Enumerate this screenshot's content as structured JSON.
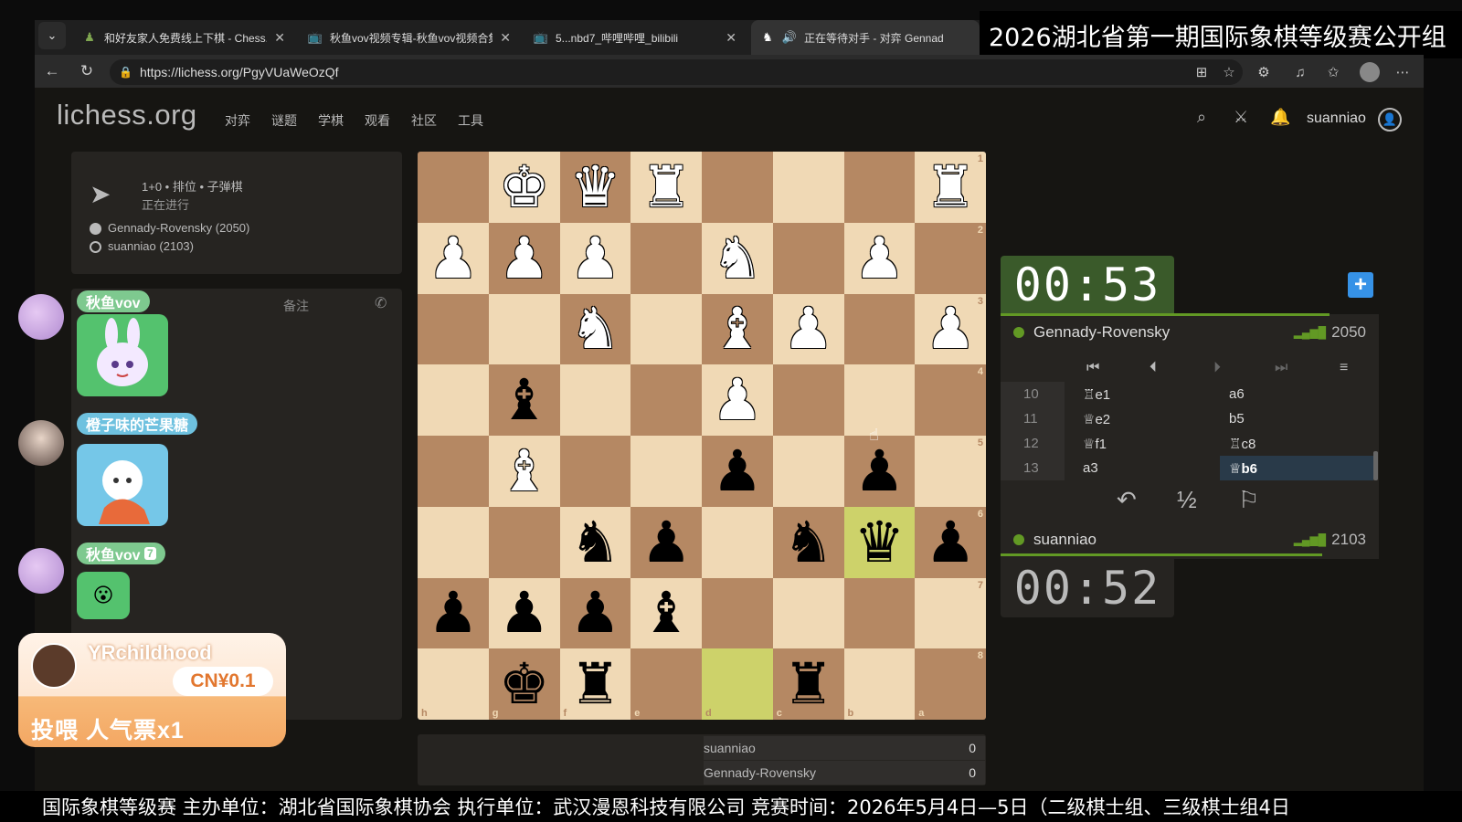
{
  "browser": {
    "tabs": [
      {
        "title": "和好友家人免费线上下棋 - Chess.c",
        "icon": "pawn-icon"
      },
      {
        "title": "秋鱼vov视频专辑-秋鱼vov视频合集",
        "icon": "bilibili-icon"
      },
      {
        "title": "5...nbd7_哔哩哔哩_bilibili",
        "icon": "bilibili-icon"
      },
      {
        "title": "正在等待对手 - 对弈 Gennad",
        "icon": "lichess-icon"
      }
    ],
    "url": "https://lichess.org/PgyVUaWeOzQf"
  },
  "stream_title": "2026湖北省第一期国际象棋等级赛公开组",
  "ticker": "国际象棋等级赛 主办单位：湖北省国际象棋协会 执行单位：武汉漫恩科技有限公司 竞赛时间：2026年5月4日—5日（二级棋士组、三级棋士组4日",
  "site": {
    "logo": "lichess.org",
    "nav": [
      "对弈",
      "谜题",
      "学棋",
      "观看",
      "社区",
      "工具"
    ],
    "username": "suanniao"
  },
  "game_info": {
    "mode": "1+0 • 排位 • 子弹棋",
    "status": "正在进行",
    "white_player": "Gennady-Rovensky (2050)",
    "black_player": "suanniao (2103)"
  },
  "chat": {
    "notes_tab": "备注",
    "messages": [
      {
        "user": "秋鱼vov",
        "badge": "7"
      },
      {
        "user": "橙子味的芒果糖"
      },
      {
        "user": "秋鱼vov",
        "badge": "7"
      }
    ],
    "gift": {
      "user": "YRchildhood",
      "amount": "CN¥0.1",
      "text": "投喂 人气票x1"
    }
  },
  "board": {
    "orientation": "black",
    "rank_labels": [
      "1",
      "2",
      "3",
      "4",
      "5",
      "6",
      "7",
      "8"
    ],
    "file_labels": [
      "h",
      "g",
      "f",
      "e",
      "d",
      "c",
      "b",
      "a"
    ],
    "pieces": [
      {
        "sq": "g1",
        "p": "K",
        "c": "w"
      },
      {
        "sq": "f1",
        "p": "Q",
        "c": "w"
      },
      {
        "sq": "e1",
        "p": "R",
        "c": "w"
      },
      {
        "sq": "a1",
        "p": "R",
        "c": "w"
      },
      {
        "sq": "h2",
        "p": "P",
        "c": "w"
      },
      {
        "sq": "g2",
        "p": "P",
        "c": "w"
      },
      {
        "sq": "f2",
        "p": "P",
        "c": "w"
      },
      {
        "sq": "d2",
        "p": "N",
        "c": "w"
      },
      {
        "sq": "b2",
        "p": "P",
        "c": "w"
      },
      {
        "sq": "f3",
        "p": "N",
        "c": "w"
      },
      {
        "sq": "d3",
        "p": "B",
        "c": "w"
      },
      {
        "sq": "c3",
        "p": "P",
        "c": "w"
      },
      {
        "sq": "a3",
        "p": "P",
        "c": "w"
      },
      {
        "sq": "g4",
        "p": "B",
        "c": "b"
      },
      {
        "sq": "d4",
        "p": "P",
        "c": "w"
      },
      {
        "sq": "g5",
        "p": "B",
        "c": "w"
      },
      {
        "sq": "d5",
        "p": "P",
        "c": "b"
      },
      {
        "sq": "b5",
        "p": "P",
        "c": "b"
      },
      {
        "sq": "f6",
        "p": "N",
        "c": "b"
      },
      {
        "sq": "e6",
        "p": "P",
        "c": "b"
      },
      {
        "sq": "c6",
        "p": "N",
        "c": "b"
      },
      {
        "sq": "b6",
        "p": "Q",
        "c": "b"
      },
      {
        "sq": "a6",
        "p": "P",
        "c": "b"
      },
      {
        "sq": "h7",
        "p": "P",
        "c": "b"
      },
      {
        "sq": "g7",
        "p": "P",
        "c": "b"
      },
      {
        "sq": "f7",
        "p": "P",
        "c": "b"
      },
      {
        "sq": "e7",
        "p": "B",
        "c": "b"
      },
      {
        "sq": "g8",
        "p": "K",
        "c": "b"
      },
      {
        "sq": "f8",
        "p": "R",
        "c": "b"
      },
      {
        "sq": "c8",
        "p": "R",
        "c": "b"
      }
    ],
    "last_move": [
      "d8",
      "b6"
    ]
  },
  "score": [
    {
      "name": "suanniao",
      "value": "0"
    },
    {
      "name": "Gennady-Rovensky",
      "value": "0"
    }
  ],
  "clocks": {
    "top": "00:53",
    "bottom": "00:52",
    "top_fill": 0.87,
    "bottom_fill": 0.85
  },
  "players": {
    "top": {
      "name": "Gennady-Rovensky",
      "rating": "2050"
    },
    "bottom": {
      "name": "suanniao",
      "rating": "2103"
    }
  },
  "moves": [
    {
      "n": "10",
      "w": "♖e1",
      "b": "a6"
    },
    {
      "n": "11",
      "w": "♕e2",
      "b": "b5"
    },
    {
      "n": "12",
      "w": "♕f1",
      "b": "♖c8"
    },
    {
      "n": "13",
      "w": "a3",
      "b": "♕b6"
    }
  ],
  "actions": {
    "takeback": "↶",
    "draw": "½",
    "resign": "⚐"
  },
  "colors": {
    "accent_green": "#629924",
    "highlight": "#aaa23a",
    "active_move": "#293a49",
    "plus_button": "#3692e7"
  }
}
